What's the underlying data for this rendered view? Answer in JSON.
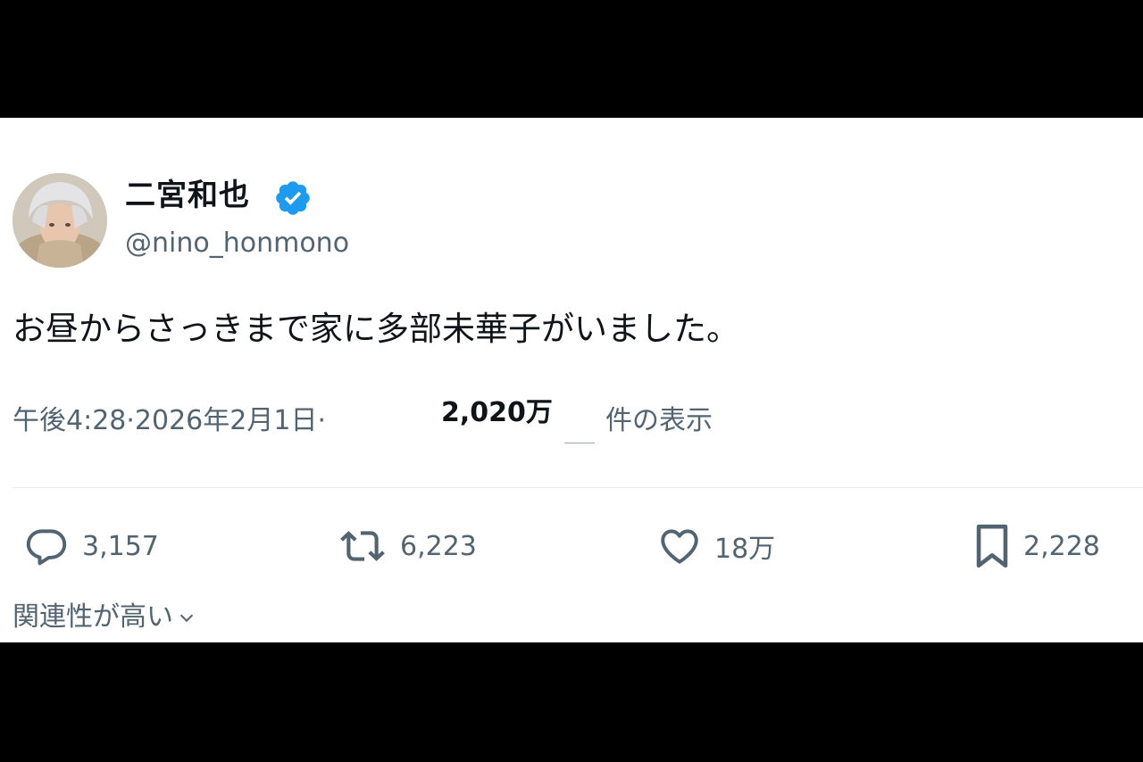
{
  "author": {
    "display_name": "二宮和也",
    "handle": "@nino_honmono",
    "verified_icon": "verified-badge-icon",
    "avatar_icon": "avatar"
  },
  "tweet": {
    "text": "お昼からさっきまで家に多部未華子がいました。"
  },
  "meta": {
    "time": "午後4:28",
    "separator1": " · ",
    "date": "2026年2月1日",
    "separator2": " · ",
    "views_count": "2,020万",
    "views_label": "件の表示"
  },
  "actions": {
    "reply": {
      "icon": "reply-icon",
      "count": "3,157"
    },
    "retweet": {
      "icon": "retweet-icon",
      "count": "6,223"
    },
    "like": {
      "icon": "heart-icon",
      "count": "18万"
    },
    "bookmark": {
      "icon": "bookmark-icon",
      "count": "2,228"
    }
  },
  "replies_sort": {
    "label": "関連性が高い",
    "icon": "chevron-down-icon"
  },
  "colors": {
    "background": "#ffffff",
    "letterbox": "#000000",
    "text_primary": "#0f1419",
    "text_secondary": "#536471",
    "verified_blue": "#1d9bf0"
  }
}
